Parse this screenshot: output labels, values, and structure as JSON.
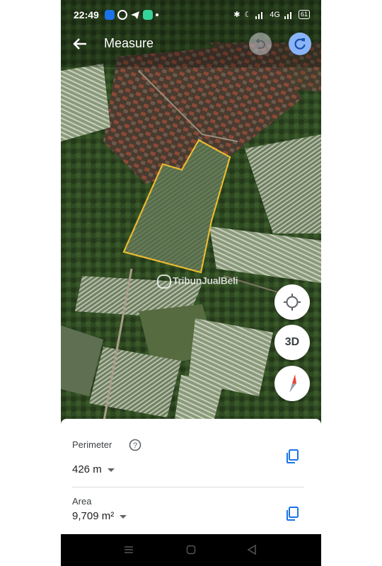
{
  "status": {
    "time": "22:49",
    "network": "4G",
    "battery": "61"
  },
  "topbar": {
    "title": "Measure"
  },
  "map": {
    "watermark": "TribunJualBeli",
    "outline_color": "#f6c026"
  },
  "controls": {
    "three_d_label": "3D"
  },
  "sheet": {
    "perimeter_label": "Perimeter",
    "perimeter_value": "426 m",
    "area_label": "Area",
    "area_value": "9,709 m²"
  },
  "colors": {
    "accent": "#1a73e8",
    "redo_bg": "#8ab4f8"
  }
}
